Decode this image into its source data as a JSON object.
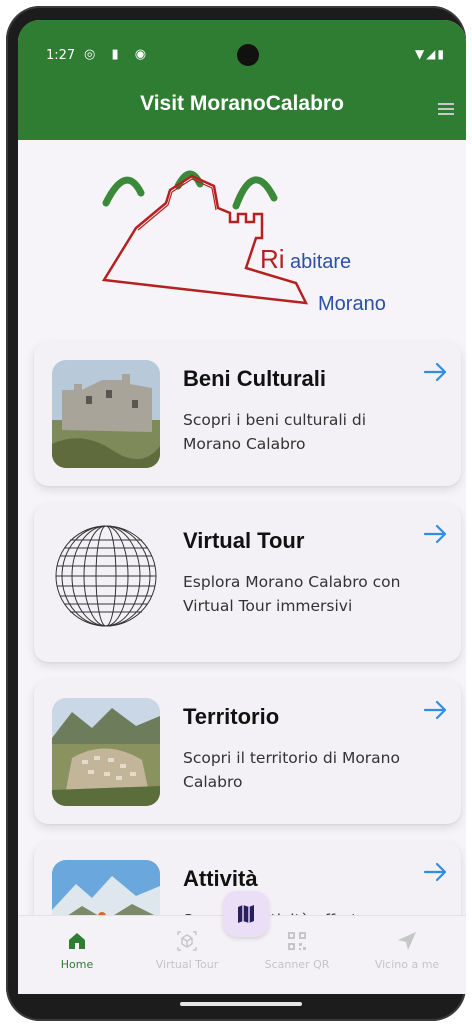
{
  "status_bar": {
    "time": "1:27"
  },
  "app_bar": {
    "title": "Visit MoranoCalabro",
    "menu_icon": "hamburger-menu-icon"
  },
  "logo": {
    "line1": "Ri",
    "line2": "abitare",
    "line3": "Morano"
  },
  "cards": [
    {
      "title": "Beni Culturali",
      "description": "Scopri i beni culturali di Morano Calabro",
      "icon": "castle-photo"
    },
    {
      "title": "Virtual Tour",
      "description": "Esplora Morano Calabro con Virtual Tour immersivi",
      "icon": "globe-wireframe"
    },
    {
      "title": "Territorio",
      "description": "Scopri il territorio di Morano Calabro",
      "icon": "town-photo"
    },
    {
      "title": "Attività",
      "description": "Scopri le attività offerte",
      "icon": "mountain-photo"
    }
  ],
  "bottom_nav": {
    "items": [
      {
        "label": "Home",
        "icon": "home-icon",
        "active": true
      },
      {
        "label": "Virtual Tour",
        "icon": "cube-icon"
      },
      {
        "label": "Scanner QR",
        "icon": "qr-code-icon"
      },
      {
        "label": "Vicino a me",
        "icon": "location-arrow-icon"
      }
    ],
    "fab_icon": "map-icon"
  },
  "colors": {
    "primary": "#2e7d32",
    "arrow": "#2f8de4",
    "logo_red": "#b52020",
    "logo_blue": "#2b50a8"
  }
}
